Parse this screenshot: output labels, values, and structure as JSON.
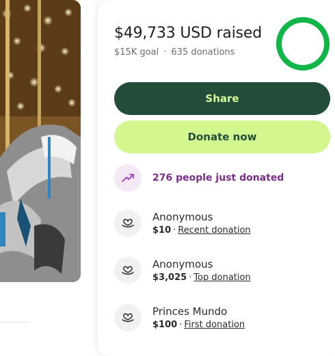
{
  "summary": {
    "raised": "$49,733 USD raised",
    "goal": "$15K goal",
    "separator": "·",
    "donations": "635 donations",
    "progress_fraction": 1.0
  },
  "buttons": {
    "share": "Share",
    "donate": "Donate now"
  },
  "activity": {
    "text": "276 people just donated",
    "icon": "trending-up-icon"
  },
  "donors": [
    {
      "name": "Anonymous",
      "amount": "$10",
      "sep": "·",
      "tag": "Recent donation",
      "icon": "heart-hand-icon"
    },
    {
      "name": "Anonymous",
      "amount": "$3,025",
      "sep": "·",
      "tag": "Top donation",
      "icon": "heart-hand-icon"
    },
    {
      "name": "Princes Mundo",
      "amount": "$100",
      "sep": "·",
      "tag": "First donation",
      "icon": "heart-hand-icon"
    }
  ],
  "colors": {
    "share_bg": "#234d38",
    "share_text": "#d6f79b",
    "donate_bg": "#d3f78e",
    "activity_text": "#7a2e8c",
    "ring_green": "#12b548"
  }
}
